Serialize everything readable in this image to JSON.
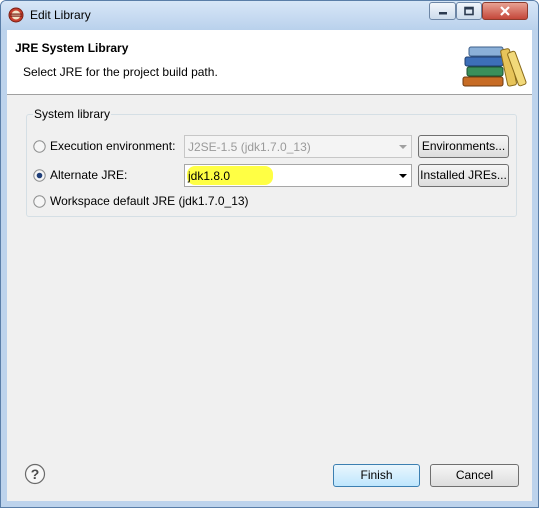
{
  "window": {
    "title": "Edit Library"
  },
  "header": {
    "title": "JRE System Library",
    "description": "Select JRE for the project build path."
  },
  "group": {
    "label": "System library",
    "execution_environment": {
      "label": "Execution environment:",
      "value": "J2SE-1.5 (jdk1.7.0_13)",
      "selected": false,
      "button": "Environments..."
    },
    "alternate_jre": {
      "label": "Alternate JRE:",
      "value": "jdk1.8.0",
      "selected": true,
      "button": "Installed JREs..."
    },
    "workspace_default": {
      "label": "Workspace default JRE (jdk1.7.0_13)",
      "selected": false
    }
  },
  "footer": {
    "finish": "Finish",
    "cancel": "Cancel"
  },
  "colors": {
    "highlight": "#ffff3a",
    "primary_button": "#bee6fd"
  }
}
